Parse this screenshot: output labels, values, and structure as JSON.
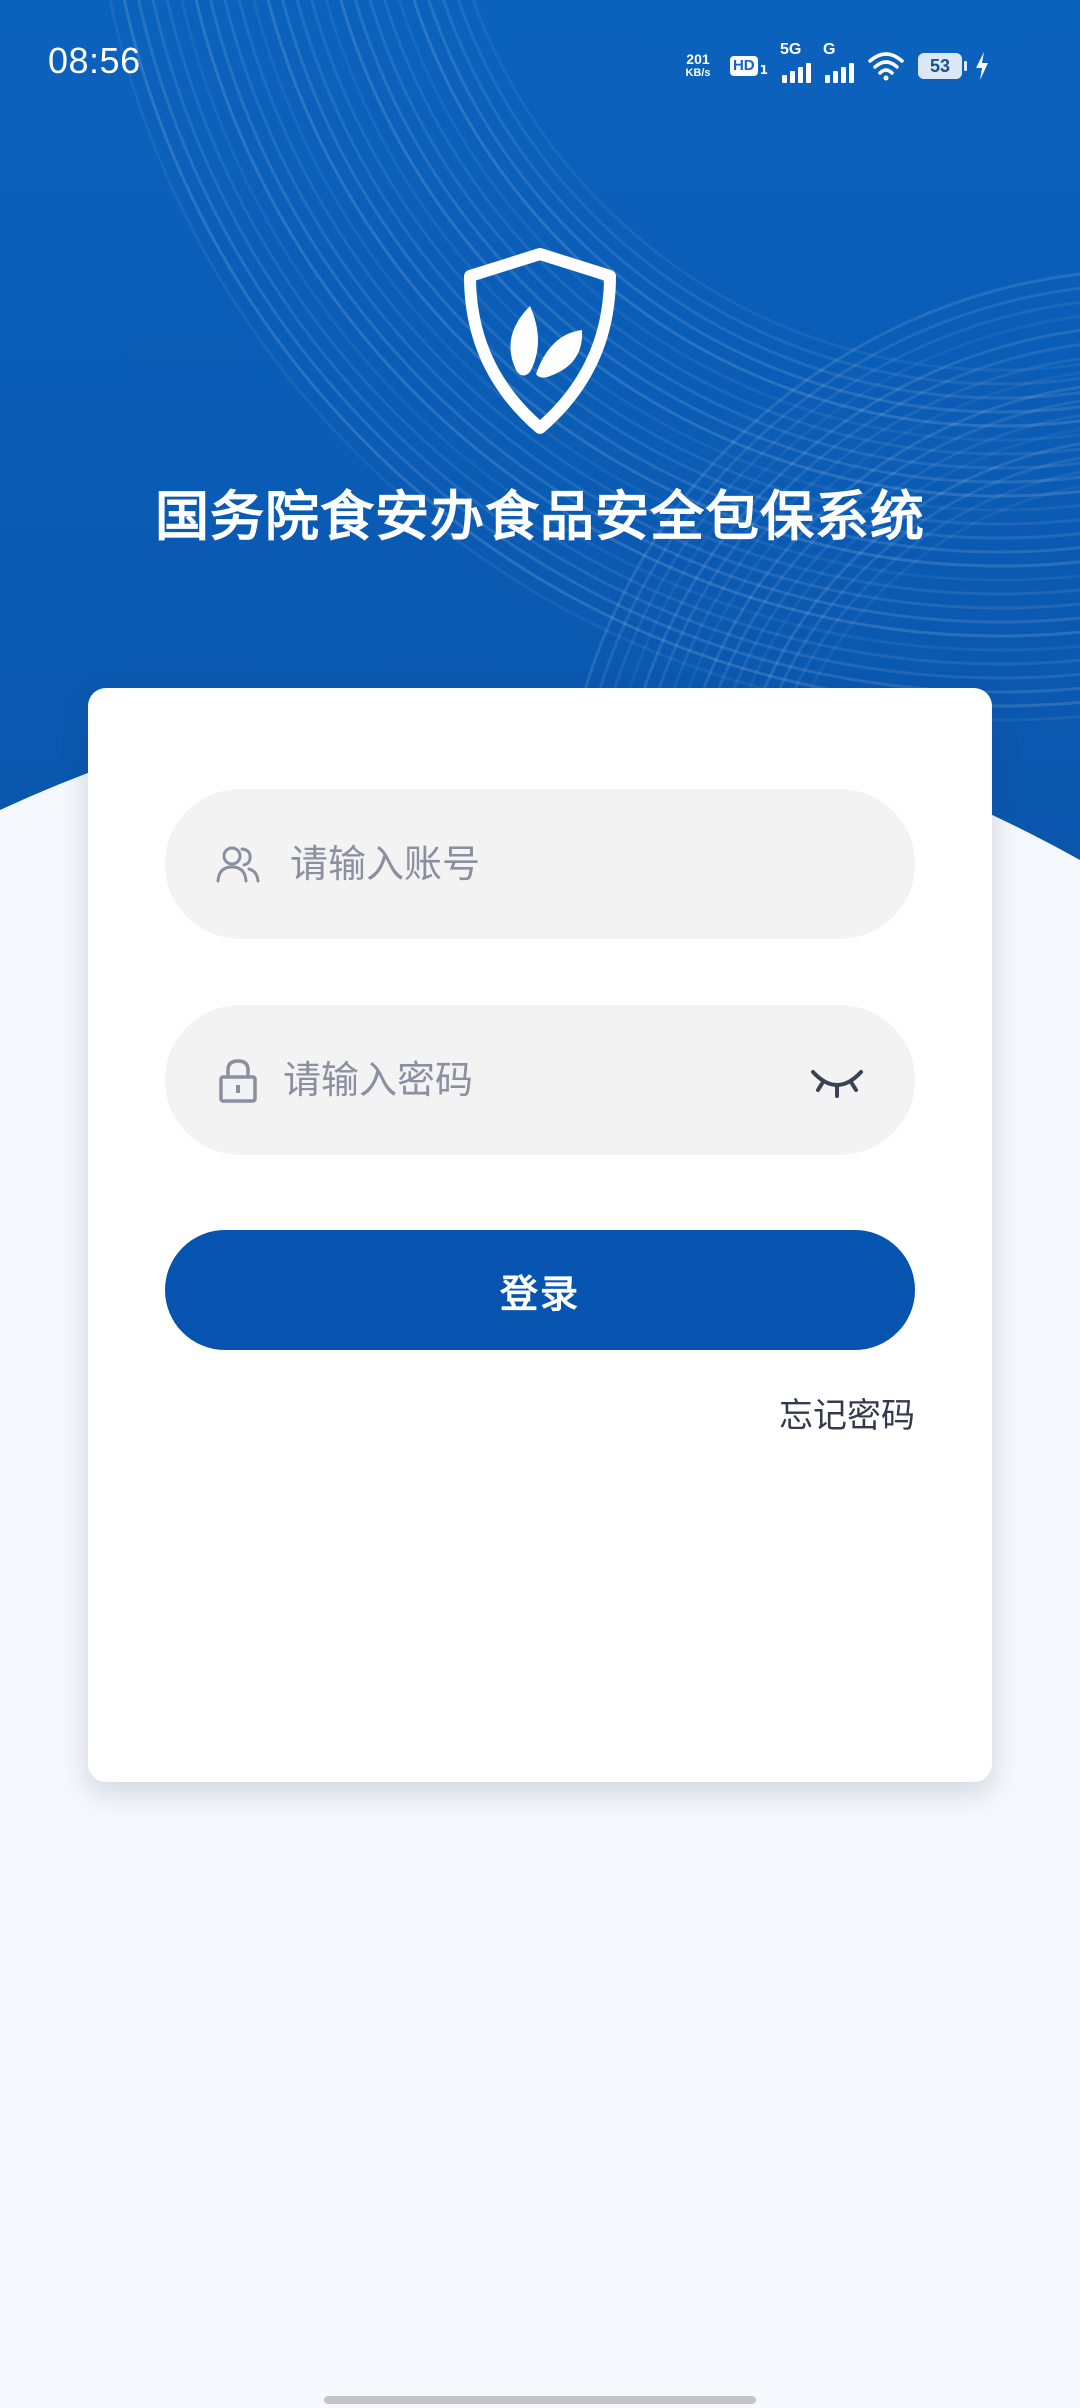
{
  "status_bar": {
    "time": "08:56",
    "network_speed_value": "201",
    "network_speed_unit": "KB/s",
    "hd_label": "HD",
    "hd_sub": "1",
    "sim1_label": "5G",
    "sim2_label": "G",
    "battery_level": "53"
  },
  "header": {
    "title": "国务院食安办食品安全包保系统"
  },
  "login_form": {
    "account_placeholder": "请输入账号",
    "password_placeholder": "请输入密码",
    "login_label": "登录",
    "forgot_label": "忘记密码"
  },
  "colors": {
    "header_blue": "#0a5db8",
    "button_blue": "#0753b0",
    "page_bg": "#f5f8fc",
    "field_bg": "#f3f3f4"
  },
  "icons": [
    "wifi-icon",
    "charging-icon",
    "shield-leaf-logo-icon",
    "user-icon",
    "lock-icon",
    "eye-closed-icon"
  ]
}
